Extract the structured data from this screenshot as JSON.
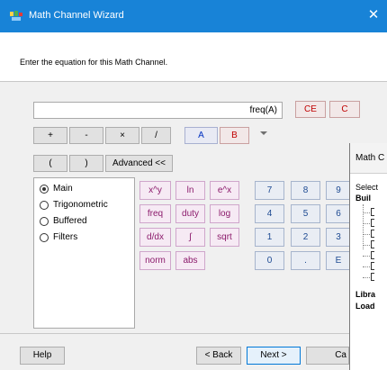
{
  "window": {
    "title": "Math Channel Wizard",
    "close_glyph": "✕",
    "icon": "app-icon"
  },
  "header": {
    "instruction": "Enter the equation for this Math Channel."
  },
  "equation": {
    "value": "freq(A)"
  },
  "buttons": {
    "ce": "CE",
    "c": "C",
    "plus": "+",
    "minus": "-",
    "times": "×",
    "divide": "/",
    "a": "A",
    "b": "B",
    "lparen": "(",
    "rparen": ")",
    "advanced": "Advanced <<"
  },
  "categories": [
    {
      "label": "Main",
      "selected": true
    },
    {
      "label": "Trigonometric",
      "selected": false
    },
    {
      "label": "Buffered",
      "selected": false
    },
    {
      "label": "Filters",
      "selected": false
    }
  ],
  "functions": {
    "xy": "x^y",
    "ln": "ln",
    "ex": "e^x",
    "freq": "freq",
    "duty": "duty",
    "log": "log",
    "ddx": "d/dx",
    "integral": "∫",
    "sqrt": "sqrt",
    "norm": "norm",
    "abs": "abs"
  },
  "keypad": {
    "k7": "7",
    "k8": "8",
    "k9": "9",
    "k4": "4",
    "k5": "5",
    "k6": "6",
    "k1": "1",
    "k2": "2",
    "k3": "3",
    "k0": "0",
    "kdot": ".",
    "ke": "E"
  },
  "footer": {
    "help": "Help",
    "back": "< Back",
    "next": "Next >",
    "cancel": "Ca"
  },
  "sub_window": {
    "title": "Math C",
    "select": "Select",
    "builtin": "Buil",
    "library": "Libra",
    "loaded": "Load"
  },
  "colors": {
    "titlebar": "#1883d7",
    "red_button_text": "#c00000",
    "blue_button_text": "#0030c0",
    "function_text": "#8b1a6b",
    "keypad_text": "#1d4a92"
  }
}
